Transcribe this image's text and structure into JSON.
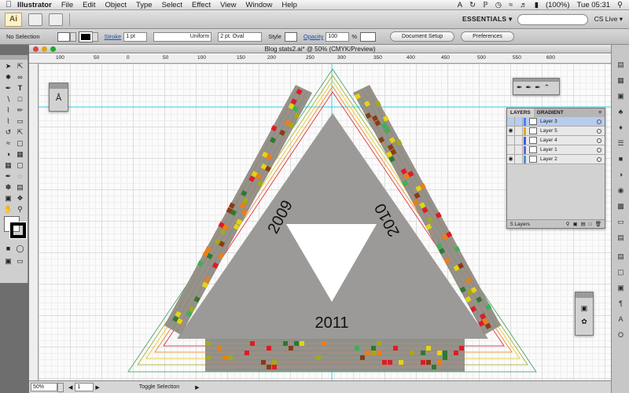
{
  "menubar": {
    "apple_icon": "apple-icon",
    "app_name": "Illustrator",
    "items": [
      "File",
      "Edit",
      "Object",
      "Type",
      "Select",
      "Effect",
      "View",
      "Window",
      "Help"
    ],
    "battery": "(100%)",
    "clock": "Tue 05:31"
  },
  "appbar": {
    "logo": "Ai",
    "workspace": "ESSENTIALS ▾",
    "cs_live": "CS Live ▾"
  },
  "control_bar": {
    "selection": "No Selection",
    "stroke_label": "Stroke",
    "stroke_weight": "1 pt",
    "profile": "Uniform",
    "brush": "2 pt. Oval",
    "style_label": "Style",
    "opacity_label": "Opacity",
    "opacity_value": "100",
    "opacity_unit": "%",
    "document_setup": "Document Setup",
    "preferences": "Preferences"
  },
  "document": {
    "title": "Blog stats2.ai* @ 50% (CMYK/Preview)",
    "ruler_marks": [
      "100",
      "50",
      "0",
      "50",
      "100",
      "150",
      "200",
      "250",
      "300",
      "350",
      "400",
      "450",
      "500",
      "550",
      "600"
    ]
  },
  "artwork": {
    "labels": {
      "y2009": "2009",
      "y2010": "2010",
      "y2011": "2011"
    },
    "colors": {
      "gray_triangle": "#9b9a98",
      "band": "#8e9189",
      "red": "#e01b24",
      "orange": "#f07d11",
      "yellow": "#e5d410",
      "olive": "#a5a81a",
      "dark_green": "#2c7a2e",
      "light_green": "#3db057",
      "brown": "#8a3b14"
    }
  },
  "layers_panel": {
    "tabs": [
      "LAYERS",
      "GRADIENT"
    ],
    "rows": [
      {
        "name": "Layer 3",
        "color": "#4f7cff",
        "selected": true
      },
      {
        "name": "Layer 5",
        "color": "#d6a82f",
        "selected": false
      },
      {
        "name": "Layer 4",
        "color": "#3b5ee0",
        "selected": false
      },
      {
        "name": "Layer 1",
        "color": "#5a6bd8",
        "selected": false
      },
      {
        "name": "Layer 2",
        "color": "#4f8fd6",
        "selected": false
      }
    ],
    "count": "5 Layers"
  },
  "status_bar": {
    "zoom": "50%",
    "artboard": "1",
    "mode": "Toggle Selection"
  }
}
